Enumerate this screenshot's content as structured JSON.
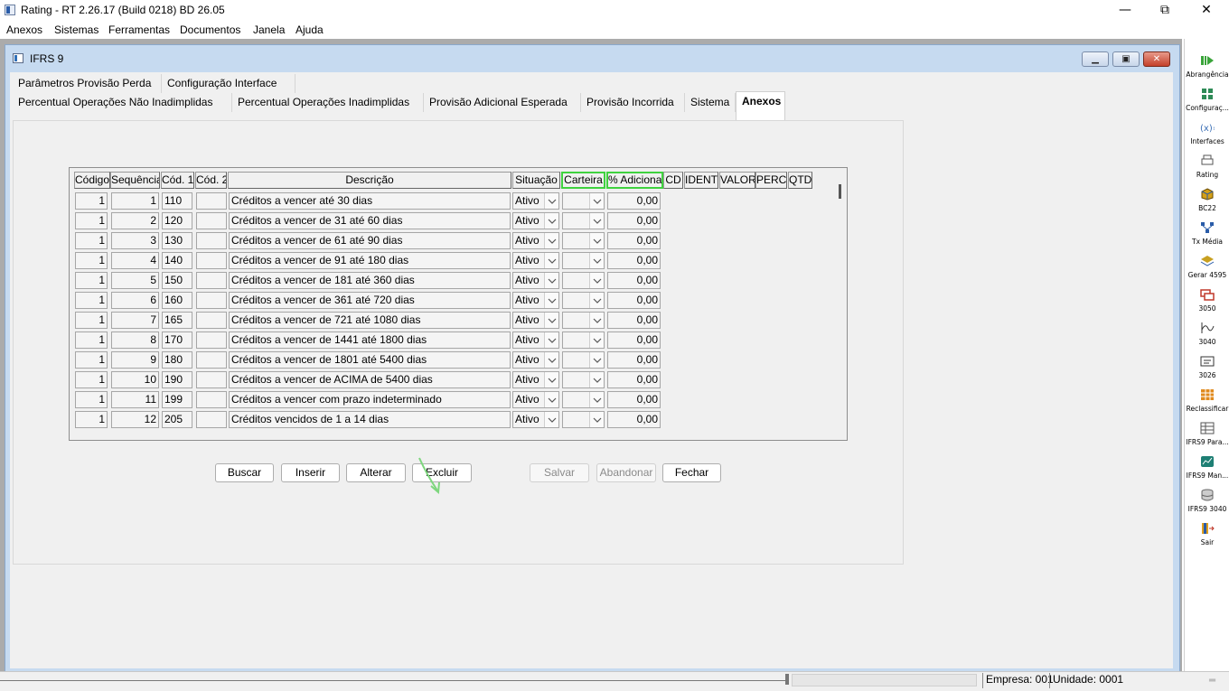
{
  "window": {
    "title": "Rating - RT 2.26.17 (Build 0218) BD 26.05",
    "controls": {
      "minimize": "—",
      "maximize": "⧉",
      "close": "✕"
    }
  },
  "menu": [
    "Anexos",
    "Sistemas",
    "Ferramentas",
    "Documentos",
    "Janela",
    "Ajuda"
  ],
  "child_window": {
    "title": "IFRS 9"
  },
  "tabs_row1": [
    "Parâmetros Provisão Perda",
    "Configuração Interface"
  ],
  "tabs_row2": [
    "Percentual Operações Não Inadimplidas",
    "Percentual Operações Inadimplidas",
    "Provisão Adicional Esperada",
    "Provisão Incorrida",
    "Sistema",
    "Anexos"
  ],
  "active_tab": "Anexos",
  "grid": {
    "columns": [
      "Código",
      "Sequência",
      "Cód. 1",
      "Cód. 2",
      "Descrição",
      "Situação",
      "Carteira",
      "% Adicional",
      "CD",
      "IDENT",
      "VALOR",
      "PERC",
      "QTD"
    ],
    "highlighted_columns": [
      "Carteira",
      "% Adicional"
    ],
    "highlight_color": "#3fd23f",
    "rows": [
      {
        "codigo": "1",
        "sequencia": "1",
        "cod1": "110",
        "cod2": "",
        "descricao": "Créditos a vencer até 30 dias",
        "situacao": "Ativo",
        "carteira": "",
        "adicional": "0,00"
      },
      {
        "codigo": "1",
        "sequencia": "2",
        "cod1": "120",
        "cod2": "",
        "descricao": "Créditos a vencer de 31 até  60 dias",
        "situacao": "Ativo",
        "carteira": "",
        "adicional": "0,00"
      },
      {
        "codigo": "1",
        "sequencia": "3",
        "cod1": "130",
        "cod2": "",
        "descricao": "Créditos a vencer de 61 até 90 dias",
        "situacao": "Ativo",
        "carteira": "",
        "adicional": "0,00"
      },
      {
        "codigo": "1",
        "sequencia": "4",
        "cod1": "140",
        "cod2": "",
        "descricao": "Créditos a vencer de 91 até 180 dias",
        "situacao": "Ativo",
        "carteira": "",
        "adicional": "0,00"
      },
      {
        "codigo": "1",
        "sequencia": "5",
        "cod1": "150",
        "cod2": "",
        "descricao": "Créditos a vencer de 181 até 360 dias",
        "situacao": "Ativo",
        "carteira": "",
        "adicional": "0,00"
      },
      {
        "codigo": "1",
        "sequencia": "6",
        "cod1": "160",
        "cod2": "",
        "descricao": "Créditos a vencer de 361 até 720 dias",
        "situacao": "Ativo",
        "carteira": "",
        "adicional": "0,00"
      },
      {
        "codigo": "1",
        "sequencia": "7",
        "cod1": "165",
        "cod2": "",
        "descricao": "Créditos a vencer de 721 até 1080 dias",
        "situacao": "Ativo",
        "carteira": "",
        "adicional": "0,00"
      },
      {
        "codigo": "1",
        "sequencia": "8",
        "cod1": "170",
        "cod2": "",
        "descricao": "Créditos a vencer de 1441 até 1800 dias",
        "situacao": "Ativo",
        "carteira": "",
        "adicional": "0,00"
      },
      {
        "codigo": "1",
        "sequencia": "9",
        "cod1": "180",
        "cod2": "",
        "descricao": "Créditos a vencer de 1801 até 5400 dias",
        "situacao": "Ativo",
        "carteira": "",
        "adicional": "0,00"
      },
      {
        "codigo": "1",
        "sequencia": "10",
        "cod1": "190",
        "cod2": "",
        "descricao": "Créditos a vencer de ACIMA de 5400 dias",
        "situacao": "Ativo",
        "carteira": "",
        "adicional": "0,00"
      },
      {
        "codigo": "1",
        "sequencia": "11",
        "cod1": "199",
        "cod2": "",
        "descricao": "Créditos a vencer com prazo indeterminado",
        "situacao": "Ativo",
        "carteira": "",
        "adicional": "0,00"
      },
      {
        "codigo": "1",
        "sequencia": "12",
        "cod1": "205",
        "cod2": "",
        "descricao": "Créditos vencidos de 1 a 14 dias",
        "situacao": "Ativo",
        "carteira": "",
        "adicional": "0,00"
      }
    ]
  },
  "buttons": {
    "buscar": "Buscar",
    "inserir": "Inserir",
    "alterar": "Alterar",
    "excluir": "Excluir",
    "salvar": "Salvar",
    "abandonar": "Abandonar",
    "fechar": "Fechar"
  },
  "toolbar": [
    {
      "label": "Abrangência",
      "icon": "play-bars-icon",
      "color": "#3aa43a"
    },
    {
      "label": "Configuraç...",
      "icon": "grid-config-icon",
      "color": "#2e8b57"
    },
    {
      "label": "Interfaces",
      "icon": "variable-x-icon",
      "color": "#3b6fb6"
    },
    {
      "label": "Rating",
      "icon": "printer-icon",
      "color": "#555555"
    },
    {
      "label": "BC22",
      "icon": "cube-icon",
      "color": "#d4a017"
    },
    {
      "label": "Tx Média",
      "icon": "network-icon",
      "color": "#2a5ca8"
    },
    {
      "label": "Gerar 4595",
      "icon": "layers-icon",
      "color": "#c8a020"
    },
    {
      "label": "3050",
      "icon": "stack-red-icon",
      "color": "#c0392b"
    },
    {
      "label": "3040",
      "icon": "wave-icon",
      "color": "#333333"
    },
    {
      "label": "3026",
      "icon": "screen-icon",
      "color": "#333333"
    },
    {
      "label": "Reclassificar",
      "icon": "grid-orange-icon",
      "color": "#e08a1e"
    },
    {
      "label": "IFRS9 Para...",
      "icon": "table-icon",
      "color": "#555555"
    },
    {
      "label": "IFRS9 Man...",
      "icon": "chart-teal-icon",
      "color": "#1e7f74"
    },
    {
      "label": "IFRS9 3040",
      "icon": "database-icon",
      "color": "#666666"
    },
    {
      "label": "Sair",
      "icon": "exit-door-icon",
      "color": "#e0a020"
    }
  ],
  "status": {
    "empresa": "Empresa: 001",
    "unidade": "Unidade: 0001"
  }
}
